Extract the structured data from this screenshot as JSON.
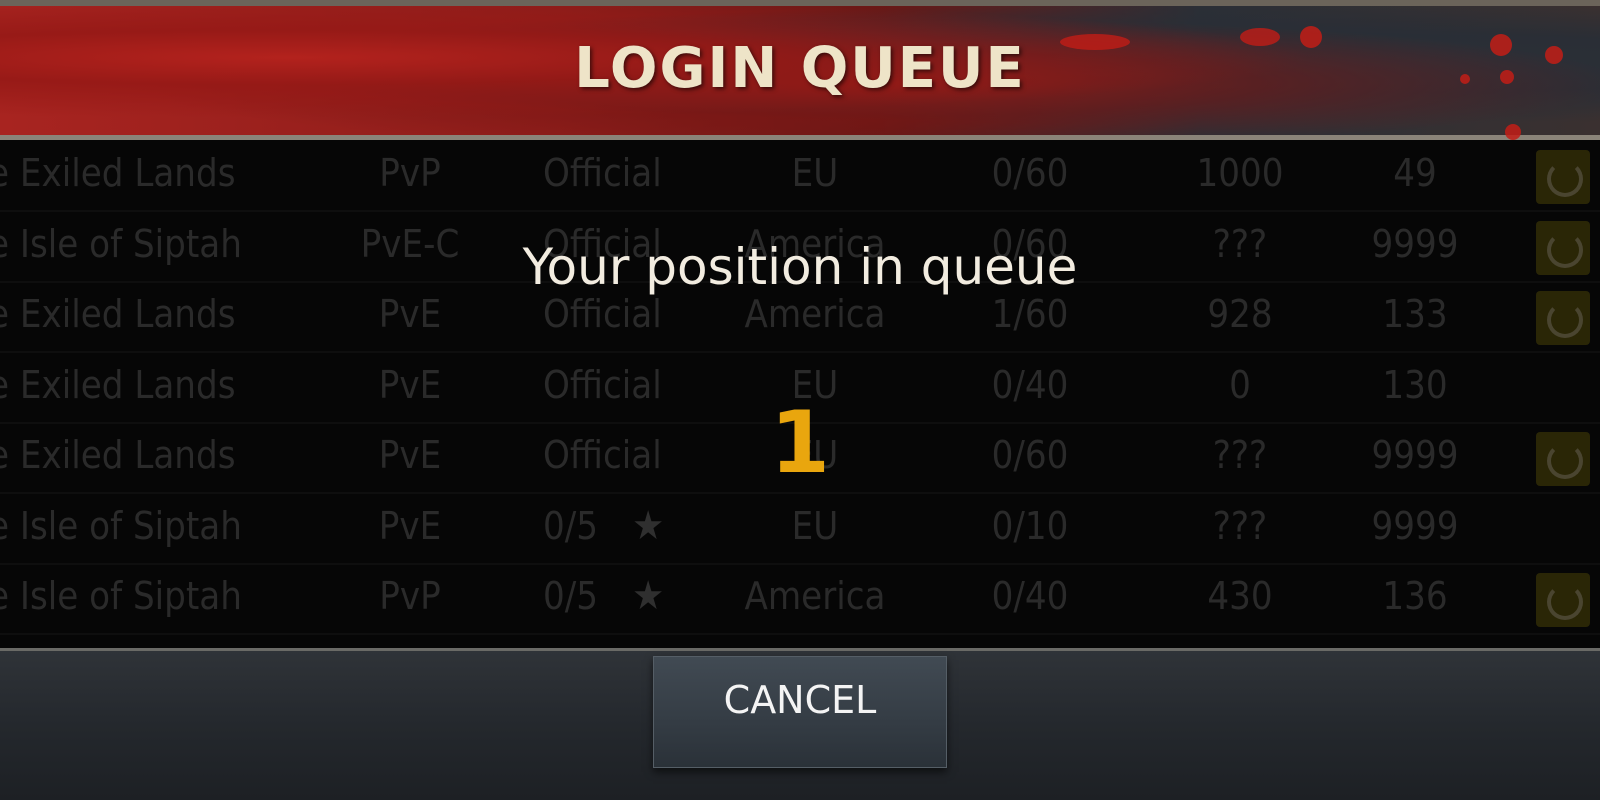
{
  "dialog": {
    "title": "LOGIN QUEUE",
    "position_label": "Your position in queue",
    "position_value": "1",
    "cancel_label": "CANCEL"
  },
  "server_list": {
    "rows": [
      {
        "map": "e Exiled Lands",
        "mode": "PvP",
        "type": "Official",
        "star": "",
        "region": "EU",
        "players": "0/60",
        "ping": "1000",
        "id": "49",
        "icon": true
      },
      {
        "map": "e Isle of Siptah",
        "mode": "PvE-C",
        "type": "Official",
        "star": "",
        "region": "America",
        "players": "0/60",
        "ping": "???",
        "id": "9999",
        "icon": true
      },
      {
        "map": "e Exiled Lands",
        "mode": "PvE",
        "type": "Official",
        "star": "",
        "region": "America",
        "players": "1/60",
        "ping": "928",
        "id": "133",
        "icon": true
      },
      {
        "map": "e Exiled Lands",
        "mode": "PvE",
        "type": "Official",
        "star": "",
        "region": "EU",
        "players": "0/40",
        "ping": "0",
        "id": "130",
        "icon": false
      },
      {
        "map": "e Exiled Lands",
        "mode": "PvE",
        "type": "Official",
        "star": "",
        "region": "EU",
        "players": "0/60",
        "ping": "???",
        "id": "9999",
        "icon": true
      },
      {
        "map": "e Isle of Siptah",
        "mode": "PvE",
        "type": "0/5",
        "star": "★",
        "region": "EU",
        "players": "0/10",
        "ping": "???",
        "id": "9999",
        "icon": false
      },
      {
        "map": "e Isle of Siptah",
        "mode": "PvP",
        "type": "0/5",
        "star": "★",
        "region": "America",
        "players": "0/40",
        "ping": "430",
        "id": "136",
        "icon": true
      }
    ]
  },
  "colors": {
    "accent_number": "#e9a60e",
    "title_text": "#eee4c8",
    "banner_red": "#a82420"
  }
}
